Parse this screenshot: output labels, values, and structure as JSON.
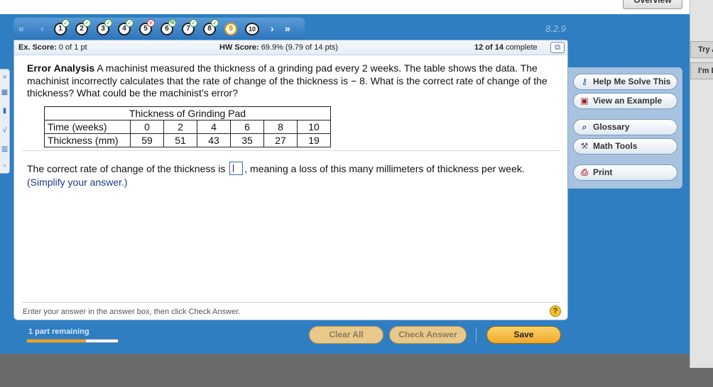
{
  "header": {
    "overview_label": "Overview",
    "section_label": "8.2.9"
  },
  "right_panel": {
    "tabs": [
      "Try A",
      "I'm Do"
    ]
  },
  "nav": {
    "questions": [
      {
        "num": "1",
        "status": "✓",
        "state": "correct"
      },
      {
        "num": "2",
        "status": "✓",
        "state": "correct"
      },
      {
        "num": "3",
        "status": "✓",
        "state": "correct"
      },
      {
        "num": "4",
        "status": "✓",
        "state": "correct"
      },
      {
        "num": "5",
        "status": "✕",
        "state": "wrong"
      },
      {
        "num": "6",
        "status": "%",
        "state": "partial"
      },
      {
        "num": "7",
        "status": "✓",
        "state": "correct"
      },
      {
        "num": "8",
        "status": "✓",
        "state": "correct"
      },
      {
        "num": "9",
        "status": "",
        "state": "current"
      },
      {
        "num": "10",
        "status": "",
        "state": "none"
      }
    ]
  },
  "score": {
    "ex_label": "Ex. Score:",
    "ex_value": "0 of 1 pt",
    "hw_label": "HW Score:",
    "hw_value": "69.9% (9.79 of 14 pts)",
    "progress_count": "12 of 14",
    "progress_suffix": "complete"
  },
  "question": {
    "title": "Error Analysis",
    "text": "A machinist measured the thickness of a grinding pad every 2 weeks. The table shows the data. The machinist incorrectly calculates that the rate of change of the thickness is  − 8. What is the correct rate of change of the thickness? What could be the machinist’s error?"
  },
  "table": {
    "caption": "Thickness of Grinding Pad",
    "row1_label": "Time (weeks)",
    "row1_values": [
      "0",
      "2",
      "4",
      "6",
      "8",
      "10"
    ],
    "row2_label": "Thickness (mm)",
    "row2_values": [
      "59",
      "51",
      "43",
      "35",
      "27",
      "19"
    ]
  },
  "answer": {
    "before": "The correct rate of change of the thickness is",
    "after": ", meaning a loss of this many millimeters of thickness per week.",
    "value": "",
    "instruction": "(Simplify your answer.)"
  },
  "footer": {
    "hint": "Enter your answer in the answer box, then click Check Answer.",
    "help_icon": "?"
  },
  "tools": {
    "help_solve": "Help Me Solve This",
    "view_example": "View an Example",
    "glossary": "Glossary",
    "math_tools": "Math Tools",
    "print": "Print"
  },
  "bottom": {
    "remaining": "1 part remaining",
    "progress_fraction": 0.65,
    "clear_all": "Clear All",
    "check_answer": "Check Answer",
    "save": "Save"
  },
  "colors": {
    "app_blue": "#2f7ec1",
    "save_orange": "#f0a928",
    "progress_orange": "#f0a020"
  }
}
